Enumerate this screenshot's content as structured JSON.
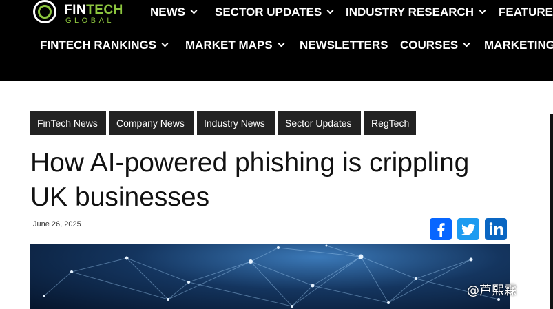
{
  "header": {
    "logo_main": "FIN",
    "logo_accent": "TECH",
    "logo_sub": "GLOBAL",
    "nav_primary": [
      {
        "label": "NEWS",
        "has_menu": true
      },
      {
        "label": "SECTOR UPDATES",
        "has_menu": true
      },
      {
        "label": "INDUSTRY RESEARCH",
        "has_menu": true
      },
      {
        "label": "FEATURES",
        "has_menu": false
      }
    ],
    "nav_secondary": [
      {
        "label": "FINTECH RANKINGS",
        "has_menu": true
      },
      {
        "label": "MARKET MAPS",
        "has_menu": true
      },
      {
        "label": "NEWSLETTERS",
        "has_menu": false
      },
      {
        "label": "COURSES",
        "has_menu": true
      },
      {
        "label": "MARKETING",
        "has_menu": false
      }
    ]
  },
  "article": {
    "tags": [
      "FinTech News",
      "Company News",
      "Industry News",
      "Sector Updates",
      "RegTech"
    ],
    "title": "How AI-powered phishing is crippling UK businesses",
    "date": "June 26, 2025"
  },
  "share": [
    {
      "name": "facebook-icon",
      "color": "#0866ff"
    },
    {
      "name": "twitter-icon",
      "color": "#1d9bf0"
    },
    {
      "name": "linkedin-icon",
      "color": "#0a66c2"
    }
  ],
  "watermark": "@芦熙霖",
  "colors": {
    "accent": "#8dc63f",
    "header_bg": "#000000",
    "tag_bg": "#222222"
  }
}
